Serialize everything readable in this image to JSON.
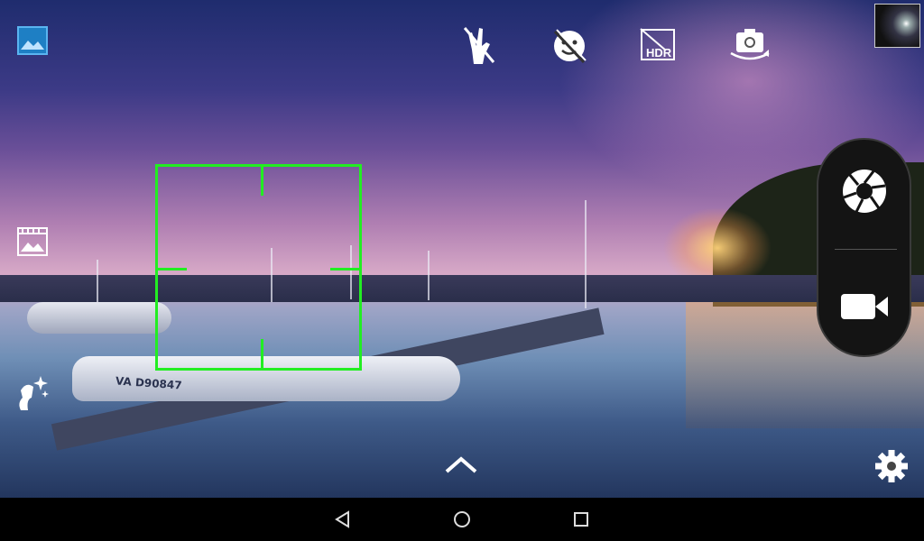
{
  "top_bar": {
    "gallery_icon": "gallery-icon",
    "gesture_icon": "gesture-shot-off-icon",
    "face_icon": "face-beauty-off-icon",
    "hdr_icon": "hdr-off-icon",
    "hdr_label": "HDR",
    "switch_camera_icon": "switch-camera-icon"
  },
  "left_bar": {
    "panorama_icon": "panorama-mode-icon",
    "magic_icon": "beauty-magic-icon"
  },
  "viewfinder": {
    "boat_registration": "VA D90847",
    "focus_color": "#22ee22"
  },
  "right_panel": {
    "shutter_icon": "shutter-aperture-icon",
    "video_icon": "video-record-icon"
  },
  "bottom": {
    "expand_icon": "chevron-up-icon",
    "settings_icon": "gear-icon"
  },
  "nav": {
    "back_icon": "back-triangle-icon",
    "home_icon": "home-circle-icon",
    "recents_icon": "recents-square-icon"
  }
}
